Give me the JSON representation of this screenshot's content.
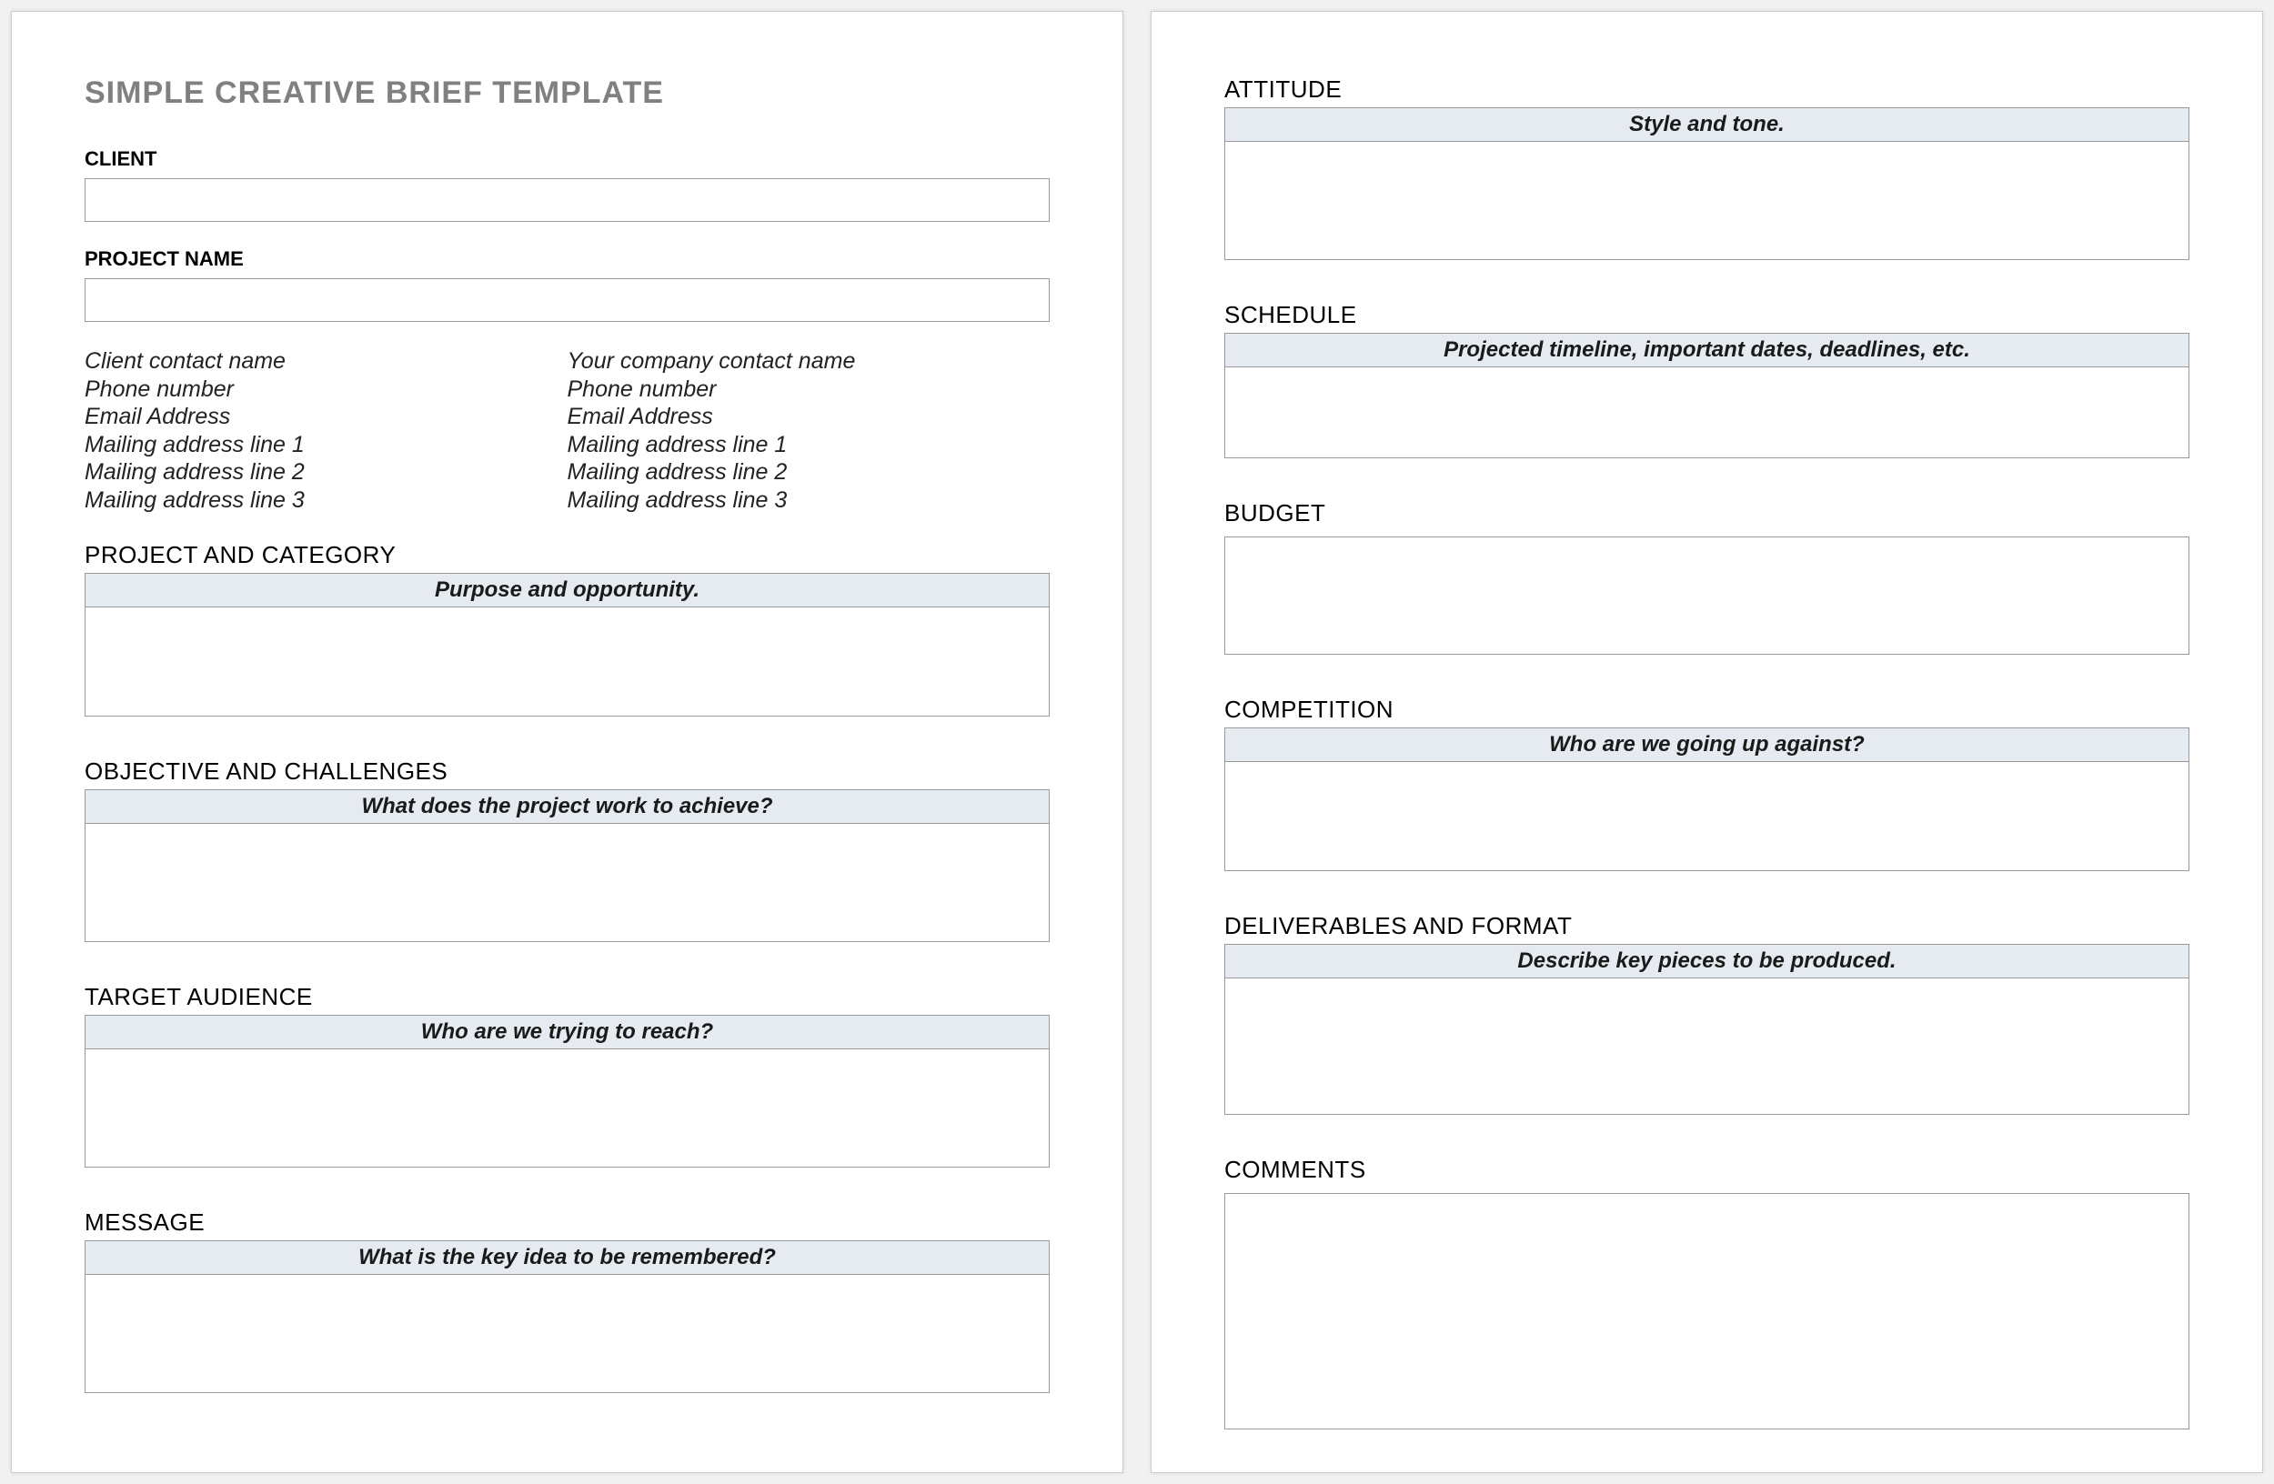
{
  "title": "SIMPLE CREATIVE BRIEF TEMPLATE",
  "fields": {
    "client_label": "CLIENT",
    "client_value": "",
    "project_name_label": "PROJECT NAME",
    "project_name_value": ""
  },
  "client_contact": {
    "name": "Client contact name",
    "phone": "Phone number",
    "email": "Email Address",
    "addr1": "Mailing address line 1",
    "addr2": "Mailing address line 2",
    "addr3": "Mailing address line 3"
  },
  "company_contact": {
    "name": "Your company contact name",
    "phone": "Phone number",
    "email": "Email Address",
    "addr1": "Mailing address line 1",
    "addr2": "Mailing address line 2",
    "addr3": "Mailing address line 3"
  },
  "sections": {
    "project_category": {
      "label": "PROJECT AND CATEGORY",
      "hint": "Purpose and opportunity."
    },
    "objective": {
      "label": "OBJECTIVE AND CHALLENGES",
      "hint": "What does the project work to achieve?"
    },
    "target_audience": {
      "label": "TARGET AUDIENCE",
      "hint": "Who are we trying to reach?"
    },
    "message": {
      "label": "MESSAGE",
      "hint": "What is the key idea to be remembered?"
    },
    "attitude": {
      "label": "ATTITUDE",
      "hint": "Style and tone."
    },
    "schedule": {
      "label": "SCHEDULE",
      "hint": "Projected timeline, important dates, deadlines, etc."
    },
    "budget": {
      "label": "BUDGET"
    },
    "competition": {
      "label": "COMPETITION",
      "hint": "Who are we going up against?"
    },
    "deliverables": {
      "label": "DELIVERABLES AND FORMAT",
      "hint": "Describe key pieces to be produced."
    },
    "comments": {
      "label": "COMMENTS"
    }
  }
}
